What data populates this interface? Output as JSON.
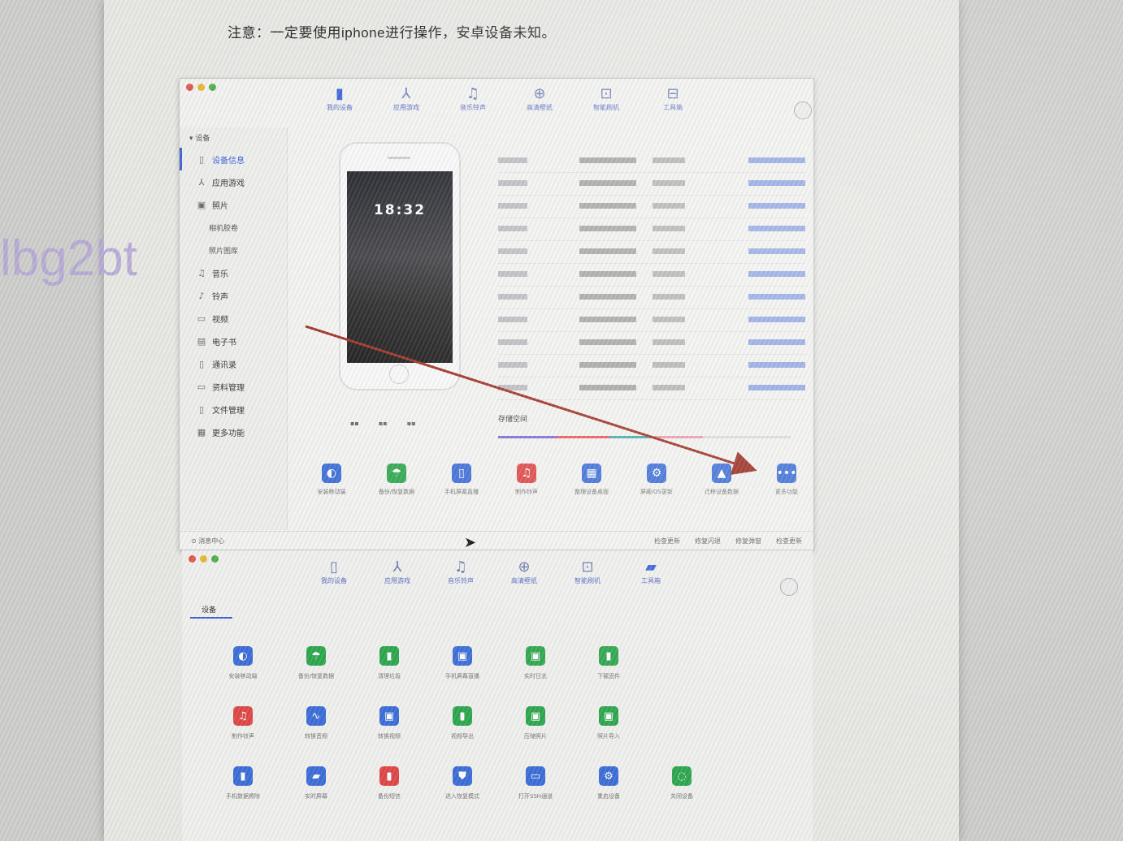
{
  "document": {
    "note": "注意：一定要使用iphone进行操作，安卓设备未知。",
    "watermark": "lbg2bt"
  },
  "window1": {
    "toolbar": [
      {
        "label": "我的设备",
        "icon": "phone-icon",
        "glyph": "▮",
        "active": true
      },
      {
        "label": "应用游戏",
        "icon": "app-store-icon",
        "glyph": "⅄"
      },
      {
        "label": "音乐铃声",
        "icon": "music-note-icon",
        "glyph": "♫"
      },
      {
        "label": "高清壁纸",
        "icon": "wallpaper-icon",
        "glyph": "⊕"
      },
      {
        "label": "智能刷机",
        "icon": "flash-icon",
        "glyph": "⊡"
      },
      {
        "label": "工具箱",
        "icon": "toolbox-icon",
        "glyph": "⊟"
      }
    ],
    "sidebar": {
      "header": "▾ 设备",
      "items": [
        {
          "label": "设备信息",
          "icon": "device-info-icon",
          "glyph": "▯",
          "active": true
        },
        {
          "label": "应用游戏",
          "icon": "apps-icon",
          "glyph": "⅄"
        },
        {
          "label": "照片",
          "icon": "photos-icon",
          "glyph": "▣"
        },
        {
          "label": "相机胶卷",
          "sub": true
        },
        {
          "label": "照片图库",
          "sub": true
        },
        {
          "label": "音乐",
          "icon": "music-icon",
          "glyph": "♫"
        },
        {
          "label": "铃声",
          "icon": "ringtone-icon",
          "glyph": "♪"
        },
        {
          "label": "视频",
          "icon": "video-icon",
          "glyph": "▭"
        },
        {
          "label": "电子书",
          "icon": "ebook-icon",
          "glyph": "▤"
        },
        {
          "label": "通讯录",
          "icon": "contacts-icon",
          "glyph": "▯"
        },
        {
          "label": "资料管理",
          "icon": "data-icon",
          "glyph": "▭"
        },
        {
          "label": "文件管理",
          "icon": "file-icon",
          "glyph": "▯"
        },
        {
          "label": "更多功能",
          "icon": "more-features-icon",
          "glyph": "▦"
        }
      ]
    },
    "phone_time": "18:32",
    "storage_label": "存储空间",
    "actions": [
      {
        "label": "安装移动端",
        "icon": "install-mobile-icon",
        "glyph": "◐",
        "color": "#3d6fd8"
      },
      {
        "label": "备份/恢复数据",
        "icon": "backup-icon",
        "glyph": "☂",
        "color": "#2fa84f"
      },
      {
        "label": "手机屏幕直播",
        "icon": "screen-mirror-icon",
        "glyph": "▯",
        "color": "#3d6fd8"
      },
      {
        "label": "制作铃声",
        "icon": "make-ringtone-icon",
        "glyph": "♫",
        "color": "#e04848"
      },
      {
        "label": "整理设备桌面",
        "icon": "organize-desktop-icon",
        "glyph": "▦",
        "color": "#3d6fd8"
      },
      {
        "label": "屏蔽iOS更新",
        "icon": "block-update-icon",
        "glyph": "⚙",
        "color": "#3d6fd8"
      },
      {
        "label": "迁移设备数据",
        "icon": "migrate-data-icon",
        "glyph": "▲",
        "color": "#3d6fd8"
      },
      {
        "label": "更多功能",
        "icon": "more-icon",
        "glyph": "•••",
        "color": "#3d6fd8"
      }
    ],
    "status": {
      "left": "⊙ 消息中心",
      "right": [
        "检查更新",
        "修复闪退",
        "修复弹窗",
        "检查更新"
      ]
    }
  },
  "window2": {
    "toolbar": [
      {
        "label": "我的设备",
        "icon": "phone-icon",
        "glyph": "▯"
      },
      {
        "label": "应用游戏",
        "icon": "app-store-icon",
        "glyph": "⅄"
      },
      {
        "label": "音乐铃声",
        "icon": "music-note-icon",
        "glyph": "♫"
      },
      {
        "label": "高清壁纸",
        "icon": "wallpaper-icon",
        "glyph": "⊕"
      },
      {
        "label": "智能刷机",
        "icon": "flash-icon",
        "glyph": "⊡"
      },
      {
        "label": "工具箱",
        "icon": "toolbox-icon",
        "glyph": "▰",
        "active": true
      }
    ],
    "tab": "设备",
    "tools": [
      {
        "label": "安装移动端",
        "icon": "install-mobile-icon",
        "glyph": "◐",
        "color": "#3d6fd8"
      },
      {
        "label": "备份/恢复数据",
        "icon": "backup-icon",
        "glyph": "☂",
        "color": "#2fa84f"
      },
      {
        "label": "清理垃圾",
        "icon": "clean-icon",
        "glyph": "▮",
        "color": "#2fa84f"
      },
      {
        "label": "手机屏幕直播",
        "icon": "screen-mirror-icon",
        "glyph": "▣",
        "color": "#3d6fd8"
      },
      {
        "label": "实时日志",
        "icon": "log-icon",
        "glyph": "▣",
        "color": "#2fa84f"
      },
      {
        "label": "下载固件",
        "icon": "firmware-icon",
        "glyph": "▮",
        "color": "#2fa84f"
      },
      {
        "label": "",
        "blank": true
      },
      {
        "label": "制作铃声",
        "icon": "make-ringtone-icon",
        "glyph": "♫",
        "color": "#e04848"
      },
      {
        "label": "转换音频",
        "icon": "audio-convert-icon",
        "glyph": "∿",
        "color": "#3d6fd8"
      },
      {
        "label": "转换视频",
        "icon": "video-convert-icon",
        "glyph": "▣",
        "color": "#3d6fd8"
      },
      {
        "label": "视频导出",
        "icon": "video-export-icon",
        "glyph": "▮",
        "color": "#2fa84f"
      },
      {
        "label": "压缩照片",
        "icon": "compress-photo-icon",
        "glyph": "▣",
        "color": "#2fa84f"
      },
      {
        "label": "照片导入",
        "icon": "photo-import-icon",
        "glyph": "▣",
        "color": "#2fa84f"
      },
      {
        "label": "",
        "blank": true
      },
      {
        "label": "手机数据擦除",
        "icon": "erase-icon",
        "glyph": "▮",
        "color": "#3d6fd8"
      },
      {
        "label": "实时屏幕",
        "icon": "realtime-screen-icon",
        "glyph": "▰",
        "color": "#3d6fd8"
      },
      {
        "label": "备份短信",
        "icon": "backup-sms-icon",
        "glyph": "▮",
        "color": "#e04848"
      },
      {
        "label": "进入恢复模式",
        "icon": "recovery-mode-icon",
        "glyph": "⛊",
        "color": "#3d6fd8"
      },
      {
        "label": "打开SSH通道",
        "icon": "ssh-icon",
        "glyph": "▭",
        "color": "#3d6fd8"
      },
      {
        "label": "重启设备",
        "icon": "restart-icon",
        "glyph": "⚙",
        "color": "#3d6fd8"
      },
      {
        "label": "关闭设备",
        "icon": "shutdown-icon",
        "glyph": "◌",
        "color": "#2fa84f"
      }
    ]
  }
}
